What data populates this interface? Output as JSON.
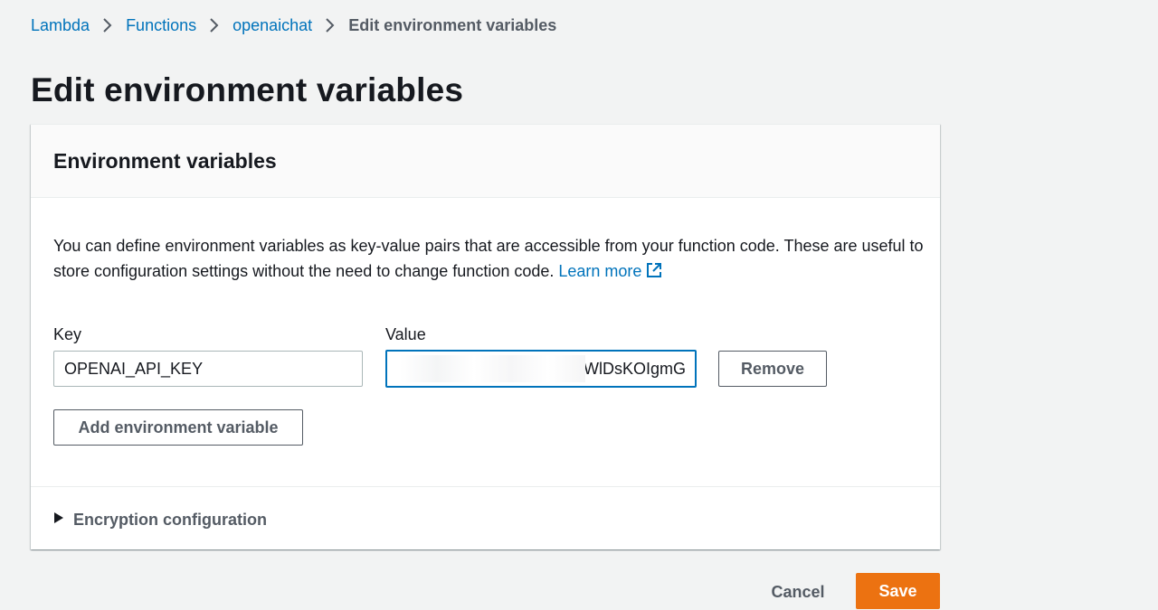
{
  "breadcrumb": {
    "items": [
      {
        "label": "Lambda"
      },
      {
        "label": "Functions"
      },
      {
        "label": "openaichat"
      },
      {
        "label": "Edit environment variables"
      }
    ]
  },
  "page": {
    "title": "Edit environment variables"
  },
  "panel": {
    "title": "Environment variables",
    "description": "You can define environment variables as key-value pairs that are accessible from your function code. These are useful to store configuration settings without the need to change function code.",
    "learn_more": "Learn more",
    "key_label": "Key",
    "value_label": "Value",
    "variables": [
      {
        "key": "OPENAI_API_KEY",
        "value_visible_suffix": "WlDsKOIgmG",
        "value_redacted": true
      }
    ],
    "remove_label": "Remove",
    "add_label": "Add environment variable",
    "encryption_label": "Encryption configuration",
    "encryption_expanded": false
  },
  "footer": {
    "cancel_label": "Cancel",
    "save_label": "Save"
  },
  "colors": {
    "link": "#0073bb",
    "primary_button": "#ec7211",
    "background": "#f2f3f3",
    "focus_border": "#0073bb"
  },
  "icons": {
    "breadcrumb_separator": "chevron-right-icon",
    "learn_more": "external-link-icon",
    "encryption_toggle": "caret-right-icon"
  }
}
